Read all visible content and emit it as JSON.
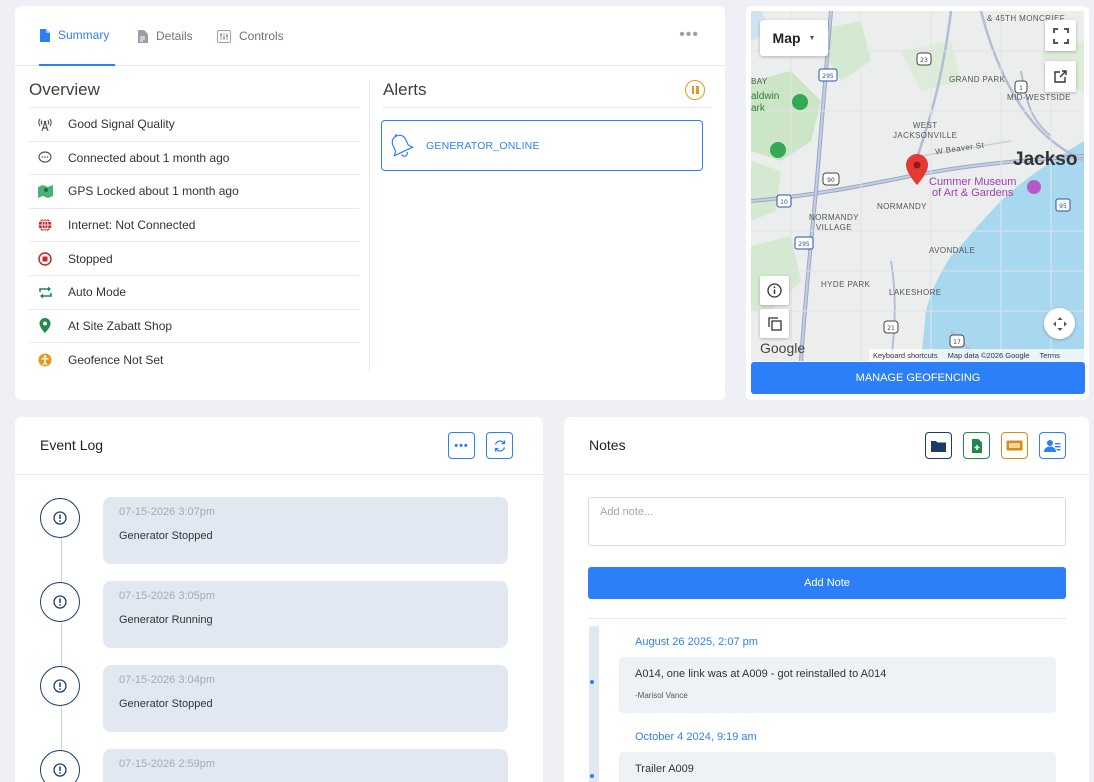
{
  "tabs": [
    {
      "label": "Summary",
      "icon": "document-icon",
      "active": true
    },
    {
      "label": "Details",
      "icon": "details-icon",
      "active": false
    },
    {
      "label": "Controls",
      "icon": "sliders-icon",
      "active": false
    }
  ],
  "overview": {
    "title": "Overview",
    "items": [
      {
        "label": "Good Signal Quality",
        "icon": "antenna-icon"
      },
      {
        "label": "Connected about 1 month ago",
        "icon": "chat-icon"
      },
      {
        "label": "GPS Locked about 1 month ago",
        "icon": "map-icon"
      },
      {
        "label": "Internet: Not Connected",
        "icon": "globe-icon"
      },
      {
        "label": "Stopped",
        "icon": "stop-icon"
      },
      {
        "label": "Auto Mode",
        "icon": "repeat-icon"
      },
      {
        "label": "At Site Zabatt Shop",
        "icon": "pin-icon"
      },
      {
        "label": "Geofence Not Set",
        "icon": "person-icon"
      }
    ]
  },
  "alerts": {
    "title": "Alerts",
    "items": [
      {
        "label": "GENERATOR_ONLINE",
        "icon": "bell-icon"
      }
    ]
  },
  "map": {
    "type_label": "Map",
    "labels": {
      "city": "Jackso",
      "museum": "Cummer Museum\nof Art & Gardens",
      "grand_park": "GRAND PARK",
      "mid_westside": "MID-WESTSIDE",
      "west_jax": "WEST\nJACKSONVILLE",
      "baldwin": "aldwin\nark",
      "bay": "BAY",
      "normandy": "NORMANDY",
      "normandy_village": "NORMANDY\nVILLAGE",
      "avondale": "AVONDALE",
      "hyde_park": "HYDE PARK",
      "lakeshore": "LAKESHORE",
      "street": "W Beaver St",
      "monc": "& 45TH\nMONCRIEF"
    },
    "shields": [
      "295",
      "23",
      "1",
      "90",
      "10",
      "295",
      "95",
      "21",
      "17"
    ],
    "google": "Google",
    "footer": [
      "Keyboard shortcuts",
      "Map data ©2026 Google",
      "Terms"
    ],
    "manage_button": "MANAGE GEOFENCING"
  },
  "event_log": {
    "title": "Event Log",
    "events": [
      {
        "date": "07-15-2026 3:07pm",
        "text": "Generator Stopped"
      },
      {
        "date": "07-15-2026 3:05pm",
        "text": "Generator Running"
      },
      {
        "date": "07-15-2026 3:04pm",
        "text": "Generator Stopped"
      },
      {
        "date": "07-15-2026 2:59pm",
        "text": ""
      }
    ]
  },
  "notes": {
    "title": "Notes",
    "placeholder": "Add note...",
    "add_button": "Add Note",
    "colors": {
      "navy": "#1b3a66",
      "green": "#1f8a4c",
      "orange": "#d88d12",
      "blue": "#2d7ff9"
    },
    "entries": [
      {
        "date": "August 26 2025, 2:07 pm",
        "text": "A014, one link was at A009 - got reinstalled to A014",
        "author": "-Marisol Vance"
      },
      {
        "date": "October 4 2024, 9:19 am",
        "text": "Trailer A009",
        "author": ""
      }
    ]
  }
}
